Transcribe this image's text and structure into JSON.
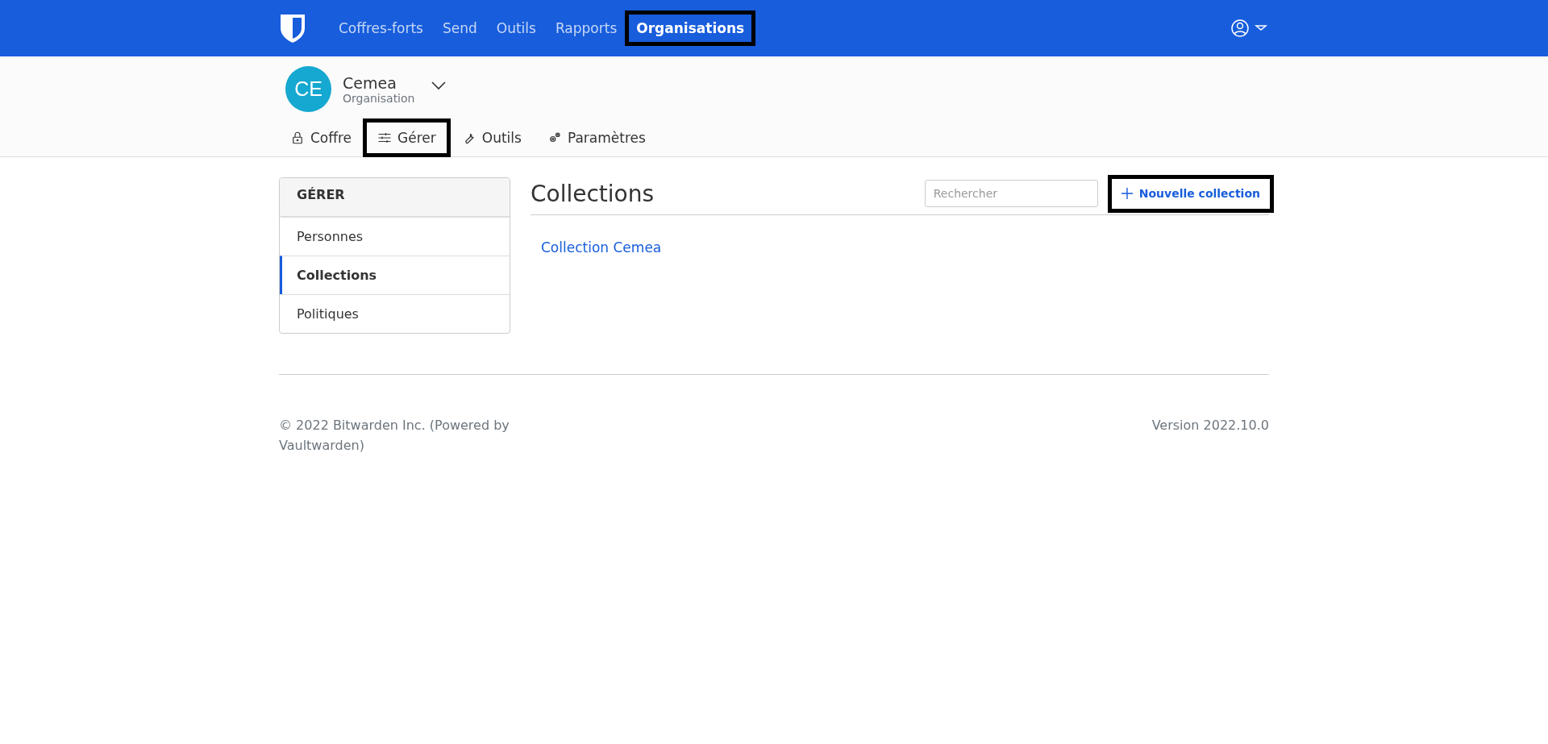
{
  "top_nav": {
    "items": [
      {
        "label": "Coffres-forts",
        "selected": false,
        "highlighted": false
      },
      {
        "label": "Send",
        "selected": false,
        "highlighted": false
      },
      {
        "label": "Outils",
        "selected": false,
        "highlighted": false
      },
      {
        "label": "Rapports",
        "selected": false,
        "highlighted": false
      },
      {
        "label": "Organisations",
        "selected": true,
        "highlighted": true
      }
    ]
  },
  "organization": {
    "initials": "CE",
    "name": "Cemea",
    "type": "Organisation"
  },
  "org_tabs": [
    {
      "kind": "lock",
      "label": "Coffre",
      "highlighted": false
    },
    {
      "kind": "sliders",
      "label": "Gérer",
      "highlighted": true
    },
    {
      "kind": "wrench",
      "label": "Outils",
      "highlighted": false
    },
    {
      "kind": "cogs",
      "label": "Paramètres",
      "highlighted": false
    }
  ],
  "sidebar": {
    "title": "GÉRER",
    "items": [
      {
        "label": "Personnes",
        "selected": false
      },
      {
        "label": "Collections",
        "selected": true
      },
      {
        "label": "Politiques",
        "selected": false
      }
    ]
  },
  "main": {
    "title": "Collections",
    "search": {
      "placeholder": "Rechercher"
    },
    "new_button": {
      "label": "Nouvelle collection",
      "highlighted": true
    },
    "collections": [
      "Collection Cemea"
    ]
  },
  "footer": {
    "copyright": "© 2022 Bitwarden Inc. (Powered by Vaultwarden)",
    "version": "Version 2022.10.0"
  }
}
